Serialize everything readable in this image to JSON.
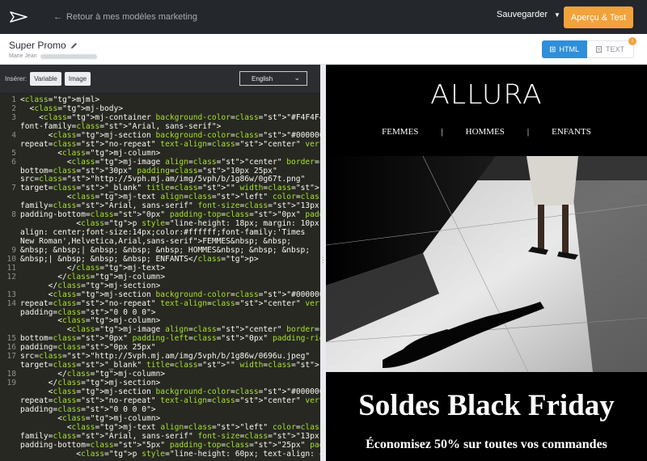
{
  "header": {
    "back_label": "Retour à mes modèles marketing",
    "save_label": "Sauvegarder",
    "preview_label": "Aperçu & Test"
  },
  "document": {
    "title": "Super Promo",
    "author": "Marie Jean"
  },
  "view_tabs": {
    "html_label": "HTML",
    "text_label": "TEXT",
    "text_badge": "!",
    "active": "HTML"
  },
  "editor_toolbar": {
    "insert_label": "Insérer:",
    "variable_label": "Variable",
    "image_label": "Image",
    "language": "English"
  },
  "code": {
    "line_numbers": [
      "1",
      "2",
      "3",
      "",
      "4",
      "",
      "5",
      "6",
      "",
      "",
      "7",
      "",
      "",
      "8",
      "",
      "",
      "",
      "9",
      "10",
      "11",
      "12",
      "",
      "13",
      "14",
      "",
      "",
      "",
      "15",
      "16",
      "17",
      "",
      "18",
      "19",
      "",
      ""
    ],
    "lines": [
      "<mjml>",
      "  <mj-body>",
      "    <mj-container background-color=\"#F4F4F4\" color=\"#55575d\"",
      "font-family=\"Arial, sans-serif\">",
      "      <mj-section background-color=\"#000000\" background-",
      "repeat=\"no-repeat\" text-align=\"center\" vertical-align=\"top\">",
      "        <mj-column>",
      "          <mj-image align=\"center\" border=\"none\" padding-",
      "bottom=\"30px\" padding=\"10px 25px\"",
      "src=\"http://5vph.mj.am/img/5vph/b/1g86w/0g67t.png\"",
      "target=\"_blank\" title=\"\" width=\"180px\"></mj-image>",
      "          <mj-text align=\"left\" color=\"#55575d\" font-",
      "family=\"Arial, sans-serif\" font-size=\"13px\" line-height=\"22px\"",
      "padding-bottom=\"0px\" padding-top=\"0px\" padding=\"10px 25px\">",
      "            <p style=\"line-height: 18px; margin: 10px 0; text-",
      "align: center;font-size:14px;color:#ffffff;font-family:'Times",
      "New Roman',Helvetica,Arial,sans-serif\">FEMMES&nbsp; &nbsp;",
      "&nbsp; &nbsp;| &nbsp; &nbsp; &nbsp; HOMMES&nbsp; &nbsp; &nbsp;",
      "&nbsp;| &nbsp; &nbsp; &nbsp; ENFANTS</p>",
      "          </mj-text>",
      "        </mj-column>",
      "      </mj-section>",
      "      <mj-section background-color=\"#000000\" background-",
      "repeat=\"no-repeat\" text-align=\"center\" vertical-align=\"top\"",
      "padding=\"0 0 0 0\">",
      "        <mj-column>",
      "          <mj-image align=\"center\" border=\"none\" padding-",
      "bottom=\"0px\" padding-left=\"0px\" padding-right=\"0px\"",
      "padding=\"0px 25px\"",
      "src=\"http://5vph.mj.am/img/5vph/b/1g86w/0696u.jpeg\"",
      "target=\"_blank\" title=\"\" width=\"780px\"></mj-image>",
      "        </mj-column>",
      "      </mj-section>",
      "      <mj-section background-color=\"#000000\" background-",
      "repeat=\"no-repeat\" text-align=\"center\" vertical-align=\"top\"",
      "padding=\"0 0 0 0\">",
      "        <mj-column>",
      "          <mj-text align=\"left\" color=\"#55575d\" font-",
      "family=\"Arial, sans-serif\" font-size=\"13px\" line-height=\"22px\"",
      "padding-bottom=\"5px\" padding-top=\"25px\" padding=\"10px 25px\">",
      "            <p style=\"line-height: 60px; text-align: center;"
    ]
  },
  "preview": {
    "brand": "ALLURA",
    "nav": [
      "FEMMES",
      "|",
      "HOMMES",
      "|",
      "ENFANTS"
    ],
    "headline": "Soldes Black Friday",
    "subline": "Économisez 50% sur toutes vos commandes"
  },
  "colors": {
    "accent_orange": "#f2a23a",
    "accent_blue": "#2f8fd8",
    "editor_bg": "#272822"
  }
}
